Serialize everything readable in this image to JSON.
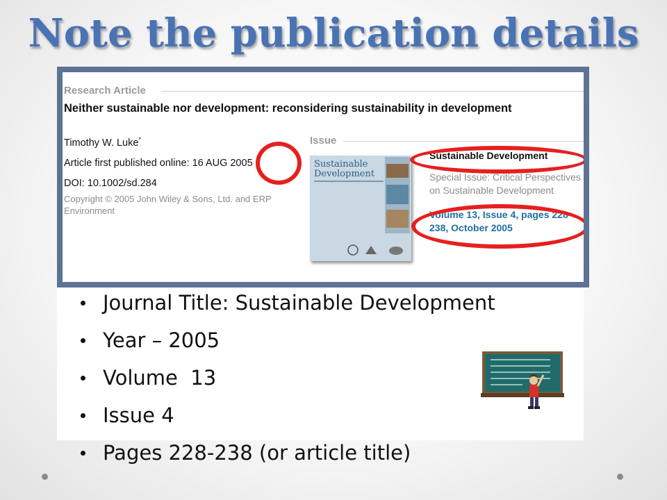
{
  "slide": {
    "title": "Note the publication details"
  },
  "screenshot": {
    "section_article": "Research Article",
    "article_title": "Neither sustainable nor development: reconsidering sustainability in development",
    "author": "Timothy W. Luke",
    "author_mark": "*",
    "published": "Article first published online: 16 AUG 2005",
    "doi": "DOI: 10.1002/sd.284",
    "copyright": "Copyright © 2005 John Wiley & Sons, Ltd. and ERP Environment",
    "section_issue": "Issue",
    "cover_title": "Sustainable Development",
    "issue_journal": "Sustainable Development",
    "issue_special": "Special Issue: Critical Perspectives on Sustainable Development",
    "issue_volume": "Volume 13, Issue 4, pages 228–238, October 2005"
  },
  "bullets": [
    "Journal Title: Sustainable Development",
    "Year – 2005",
    "Volume  13",
    "Issue 4",
    "Pages 228-238 (or article title)"
  ],
  "colors": {
    "title": "#4a73b4",
    "frame": "#5c7394",
    "highlight_ring": "#e5201f",
    "link_blue": "#1f6fa0"
  },
  "icons": {
    "clipart": "teacher-at-chalkboard-icon"
  }
}
